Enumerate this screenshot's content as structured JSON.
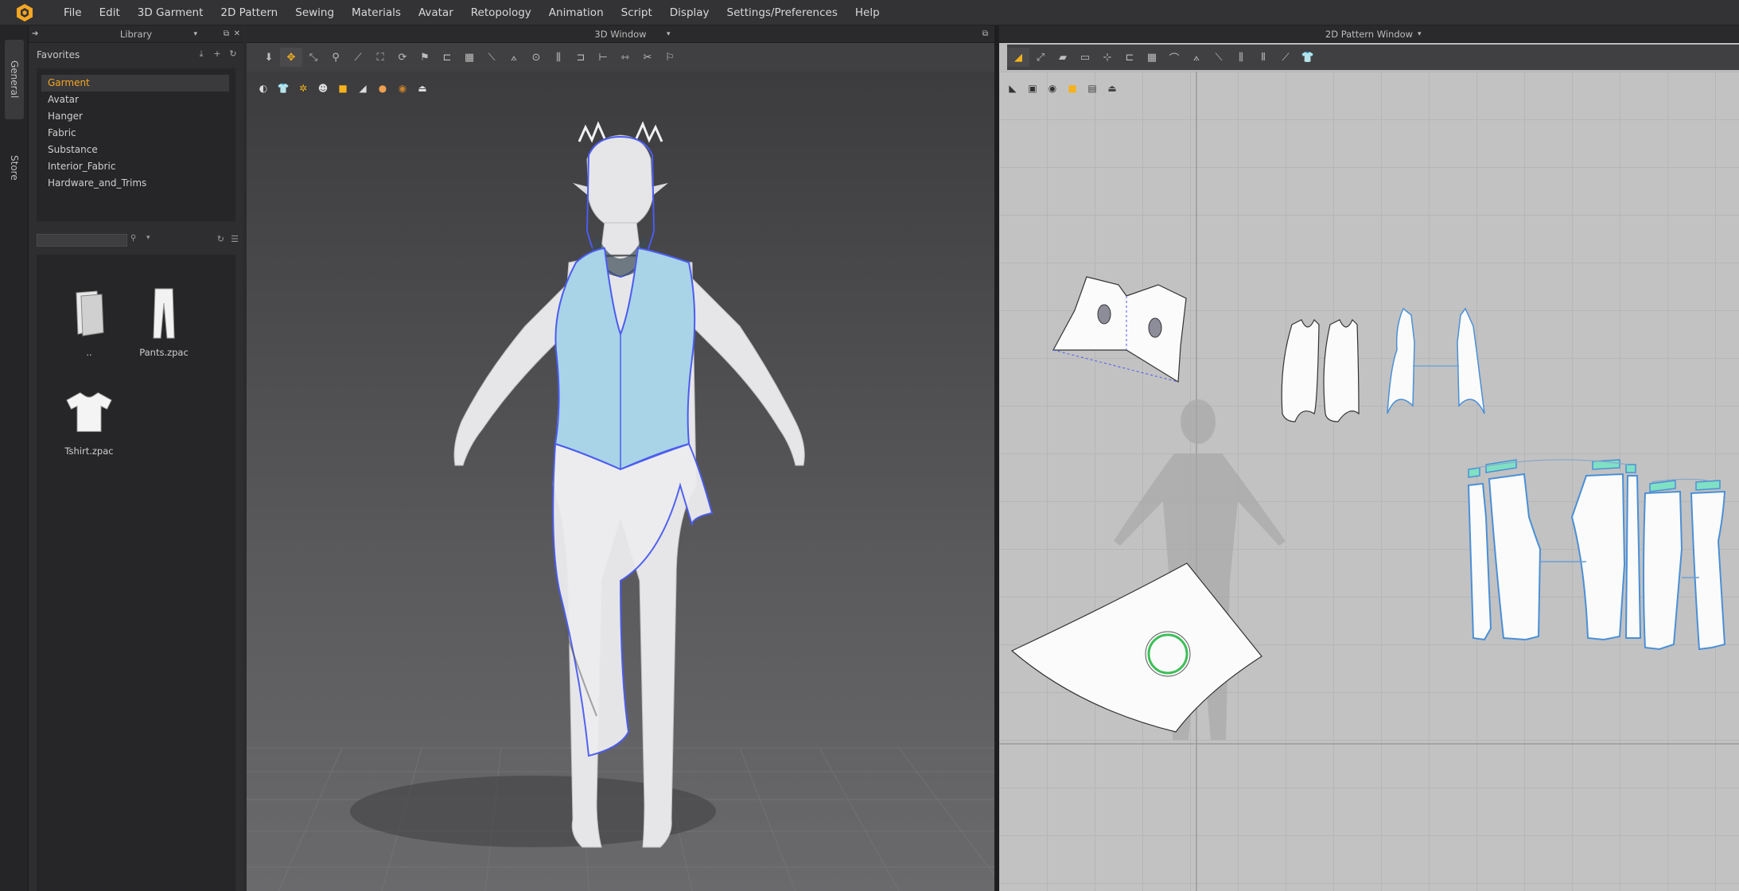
{
  "menu": [
    "File",
    "Edit",
    "3D Garment",
    "2D Pattern",
    "Sewing",
    "Materials",
    "Avatar",
    "Retopology",
    "Animation",
    "Script",
    "Display",
    "Settings/Preferences",
    "Help"
  ],
  "side_tabs": {
    "general": "General",
    "store": "Store"
  },
  "library": {
    "title": "Library",
    "favorites_label": "Favorites",
    "favorites": [
      "Garment",
      "Avatar",
      "Hanger",
      "Fabric",
      "Substance",
      "Interior_Fabric",
      "Hardware_and_Trims"
    ],
    "active_favorite": "Garment",
    "search_value": "",
    "files": [
      {
        "name": "..",
        "icon": "folder-up-icon"
      },
      {
        "name": "Pants.zpac",
        "icon": "pants-icon"
      },
      {
        "name": "Tshirt.zpac",
        "icon": "tshirt-icon"
      }
    ]
  },
  "window3d": {
    "title": "3D Window"
  },
  "window2d": {
    "title": "2D Pattern Window"
  },
  "colors": {
    "accent": "#f5a623",
    "selection": "#4b5cf0",
    "garment_light": "#a9d3e6",
    "pattern_bg": "#c2c2c2"
  }
}
